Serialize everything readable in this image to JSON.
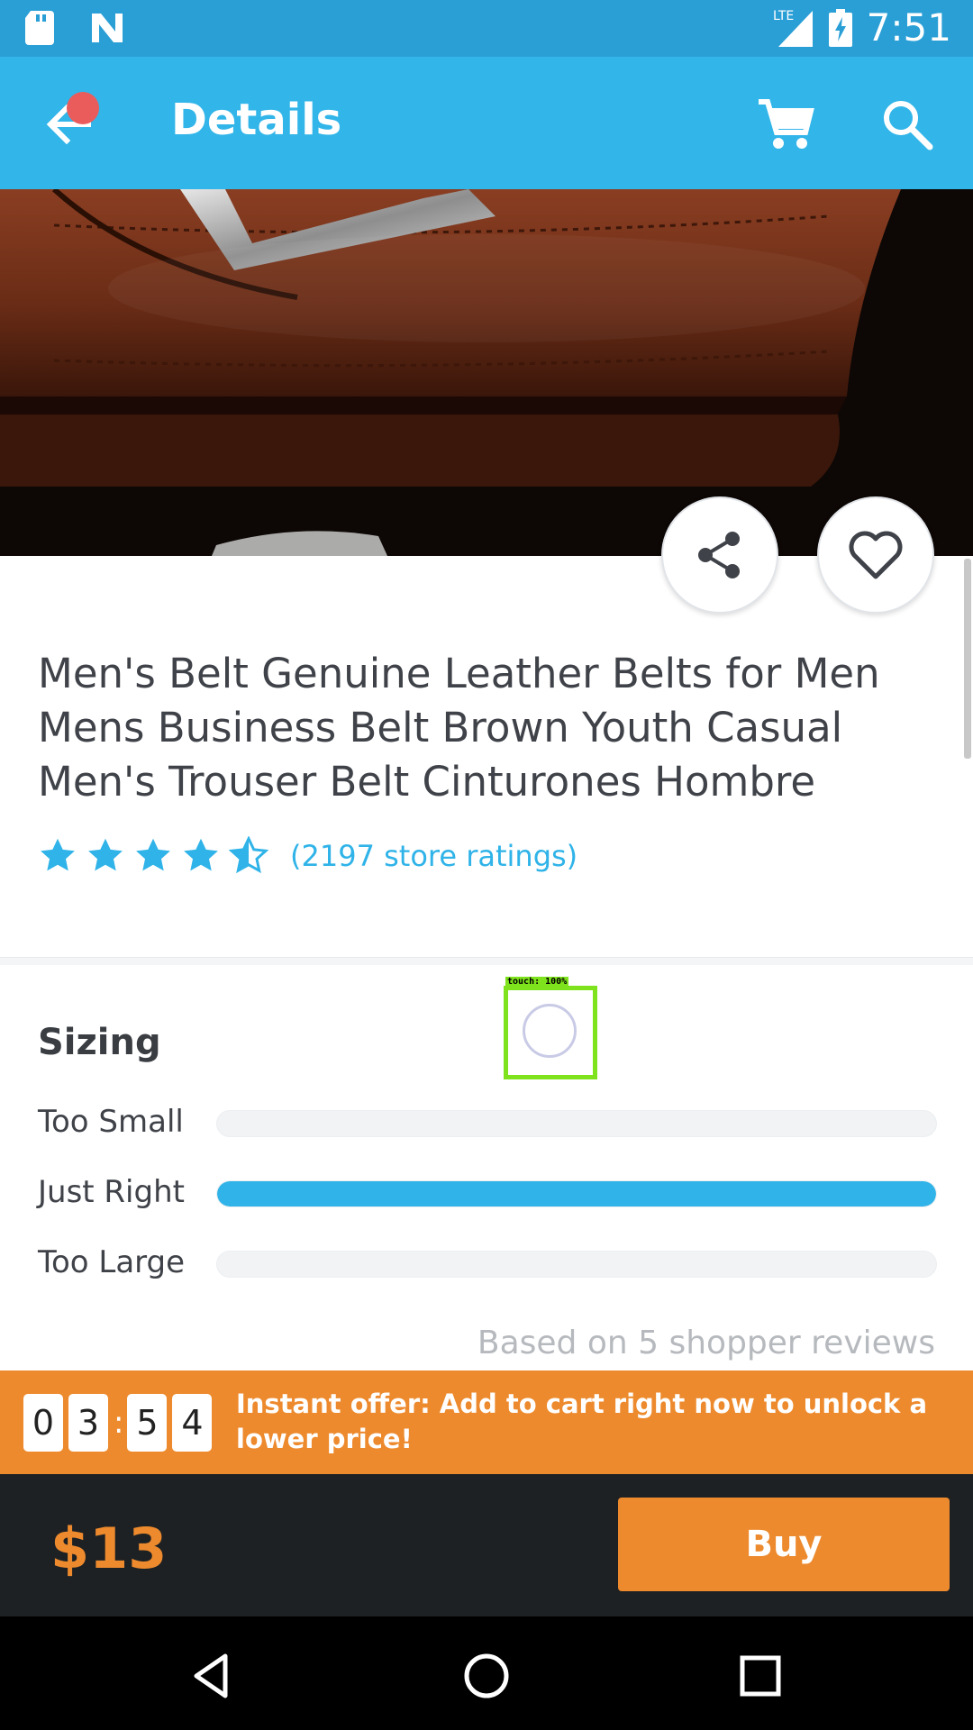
{
  "status_bar": {
    "time": "7:51",
    "network": "LTE",
    "icons": [
      "sd-card-icon",
      "n-logo-icon",
      "signal-icon",
      "battery-charging-icon"
    ]
  },
  "app_bar": {
    "title": "Details",
    "icons": [
      "back-arrow-icon",
      "cart-icon",
      "search-icon"
    ],
    "notification_dot_color": "#ea5c5c",
    "background_color": "#32b5e9"
  },
  "product": {
    "image": "brown leather belt with metal buckle",
    "actions": [
      "share-icon",
      "heart-icon"
    ],
    "title": "Men's Belt Genuine Leather Belts for Men Mens Business Belt Brown Youth Casual Men's Trouser Belt Cinturones Hombre",
    "rating": 4.5,
    "rating_max": 5,
    "rating_text": "(2197 store ratings)",
    "accent_color": "#2fb3e8"
  },
  "sizing": {
    "title": "Sizing",
    "rows": [
      {
        "label": "Too Small",
        "fraction": 0.0
      },
      {
        "label": "Just Right",
        "fraction": 1.0
      },
      {
        "label": "Too Large",
        "fraction": 0.0
      }
    ],
    "note": "Based on 5 shopper reviews"
  },
  "touch_overlay": {
    "label": "touch: 100%",
    "color": "#7ee21c"
  },
  "offer": {
    "timer_digits": [
      "0",
      "3",
      "5",
      "4"
    ],
    "timer_separator": ":",
    "text": "Instant offer: Add to cart right now to unlock a lower price!",
    "color": "#ed8a2d"
  },
  "buy_bar": {
    "price": "$13",
    "button_label": "Buy"
  },
  "nav_bar": {
    "icons": [
      "back-triangle-icon",
      "home-circle-icon",
      "recents-square-icon"
    ]
  }
}
